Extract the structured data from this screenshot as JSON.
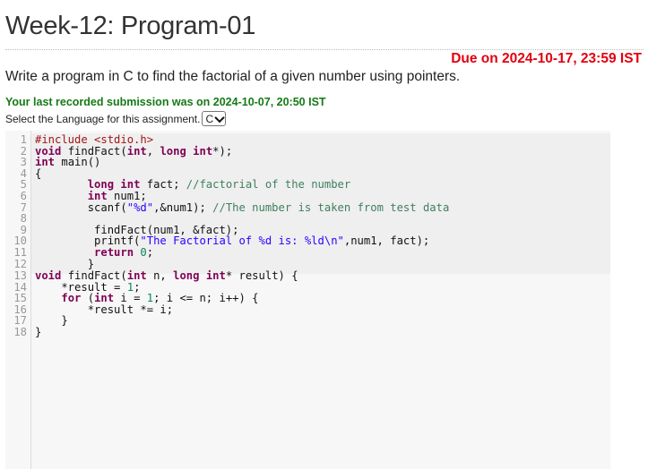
{
  "page": {
    "title": "Week-12: Program-01",
    "due": "Due on 2024-10-17, 23:59 IST",
    "description": "Write a program in C to find the factorial of a given number using pointers.",
    "submission_note": "Your last recorded submission was on 2024-10-07, 20:50 IST",
    "language_prompt": "Select the Language for this assignment.",
    "language_selected": "C"
  },
  "colors": {
    "due": "#e3000f",
    "submission": "#157a15",
    "keyword": "#7f0055",
    "comment": "#3f7f5f",
    "string": "#2a00ff",
    "preprocessor": "#a21515"
  },
  "editor": {
    "line_numbers": [
      "1",
      "2",
      "3",
      "4",
      "5",
      "6",
      "7",
      "8",
      "9",
      "10",
      "11",
      "12",
      "13",
      "14",
      "15",
      "16",
      "17",
      "18"
    ],
    "code": [
      "#include <stdio.h>",
      "void findFact(int, long int*);",
      "int main()",
      "{",
      "        long int fact; //factorial of the number",
      "        int num1;",
      "        scanf(\"%d\",&num1); //The number is taken from test data",
      "",
      "         findFact(num1, &fact);",
      "         printf(\"The Factorial of %d is: %ld\\n\",num1, fact);",
      "         return 0;",
      "        }",
      "void findFact(int n, long int* result) {",
      "    *result = 1;",
      "    for (int i = 1; i <= n; i++) {",
      "        *result *= i;",
      "    }",
      "}"
    ]
  }
}
